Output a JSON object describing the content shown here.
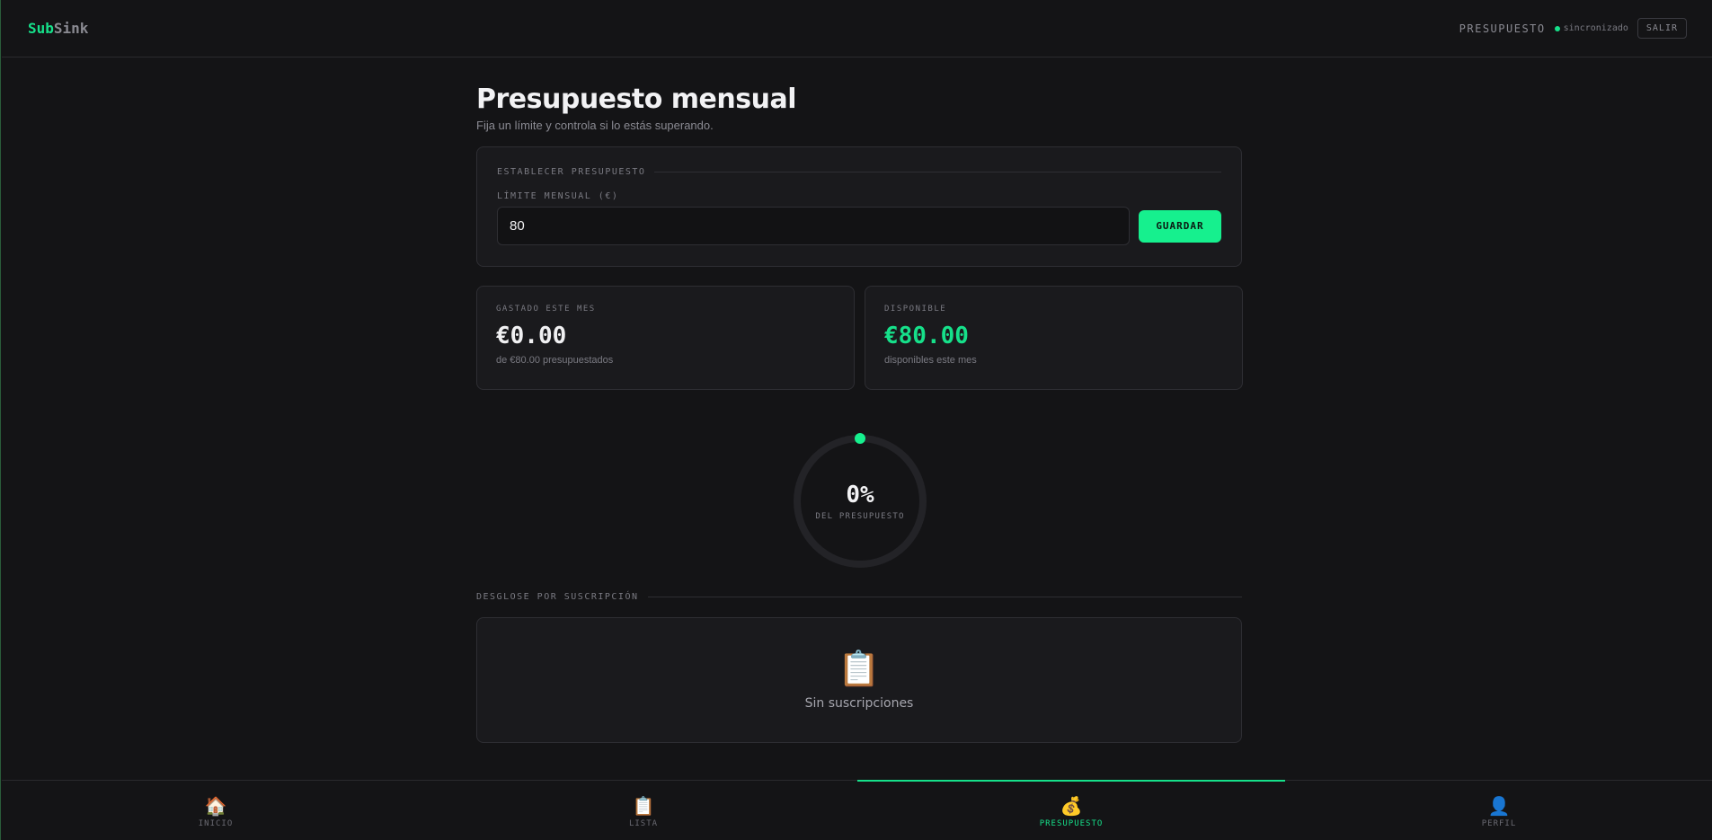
{
  "brand": {
    "part1": "Sub",
    "part2": "Sink"
  },
  "header": {
    "section": "PRESUPUESTO",
    "sync_status": "sincronizado",
    "logout_label": "SALIR"
  },
  "page": {
    "title": "Presupuesto mensual",
    "subtitle": "Fija un límite y controla si lo estás superando."
  },
  "budget_form": {
    "section_label": "ESTABLECER PRESUPUESTO",
    "field_label": "LÍMITE MENSUAL (€)",
    "value": "80",
    "save_label": "GUARDAR"
  },
  "stats": {
    "spent": {
      "label": "GASTADO ESTE MES",
      "value": "€0.00",
      "note": "de €80.00 presupuestados"
    },
    "available": {
      "label": "DISPONIBLE",
      "value": "€80.00",
      "note": "disponibles este mes"
    }
  },
  "progress": {
    "percent_text": "0%",
    "label": "DEL PRESUPUESTO",
    "fraction": 0
  },
  "breakdown": {
    "section_label": "DESGLOSE POR SUSCRIPCIÓN",
    "empty_icon": "clipboard-icon",
    "empty_text": "Sin suscripciones"
  },
  "nav": {
    "items": [
      {
        "label": "INICIO",
        "icon": "house-icon",
        "glyph": "🏠",
        "active": false
      },
      {
        "label": "LISTA",
        "icon": "clipboard-icon",
        "glyph": "📋",
        "active": false
      },
      {
        "label": "PRESUPUESTO",
        "icon": "money-bag-icon",
        "glyph": "💰",
        "active": true
      },
      {
        "label": "PERFIL",
        "icon": "user-icon",
        "glyph": "👤",
        "active": false
      }
    ]
  },
  "colors": {
    "accent": "#16e08a",
    "background": "#141416",
    "card": "#1a1a1d"
  }
}
